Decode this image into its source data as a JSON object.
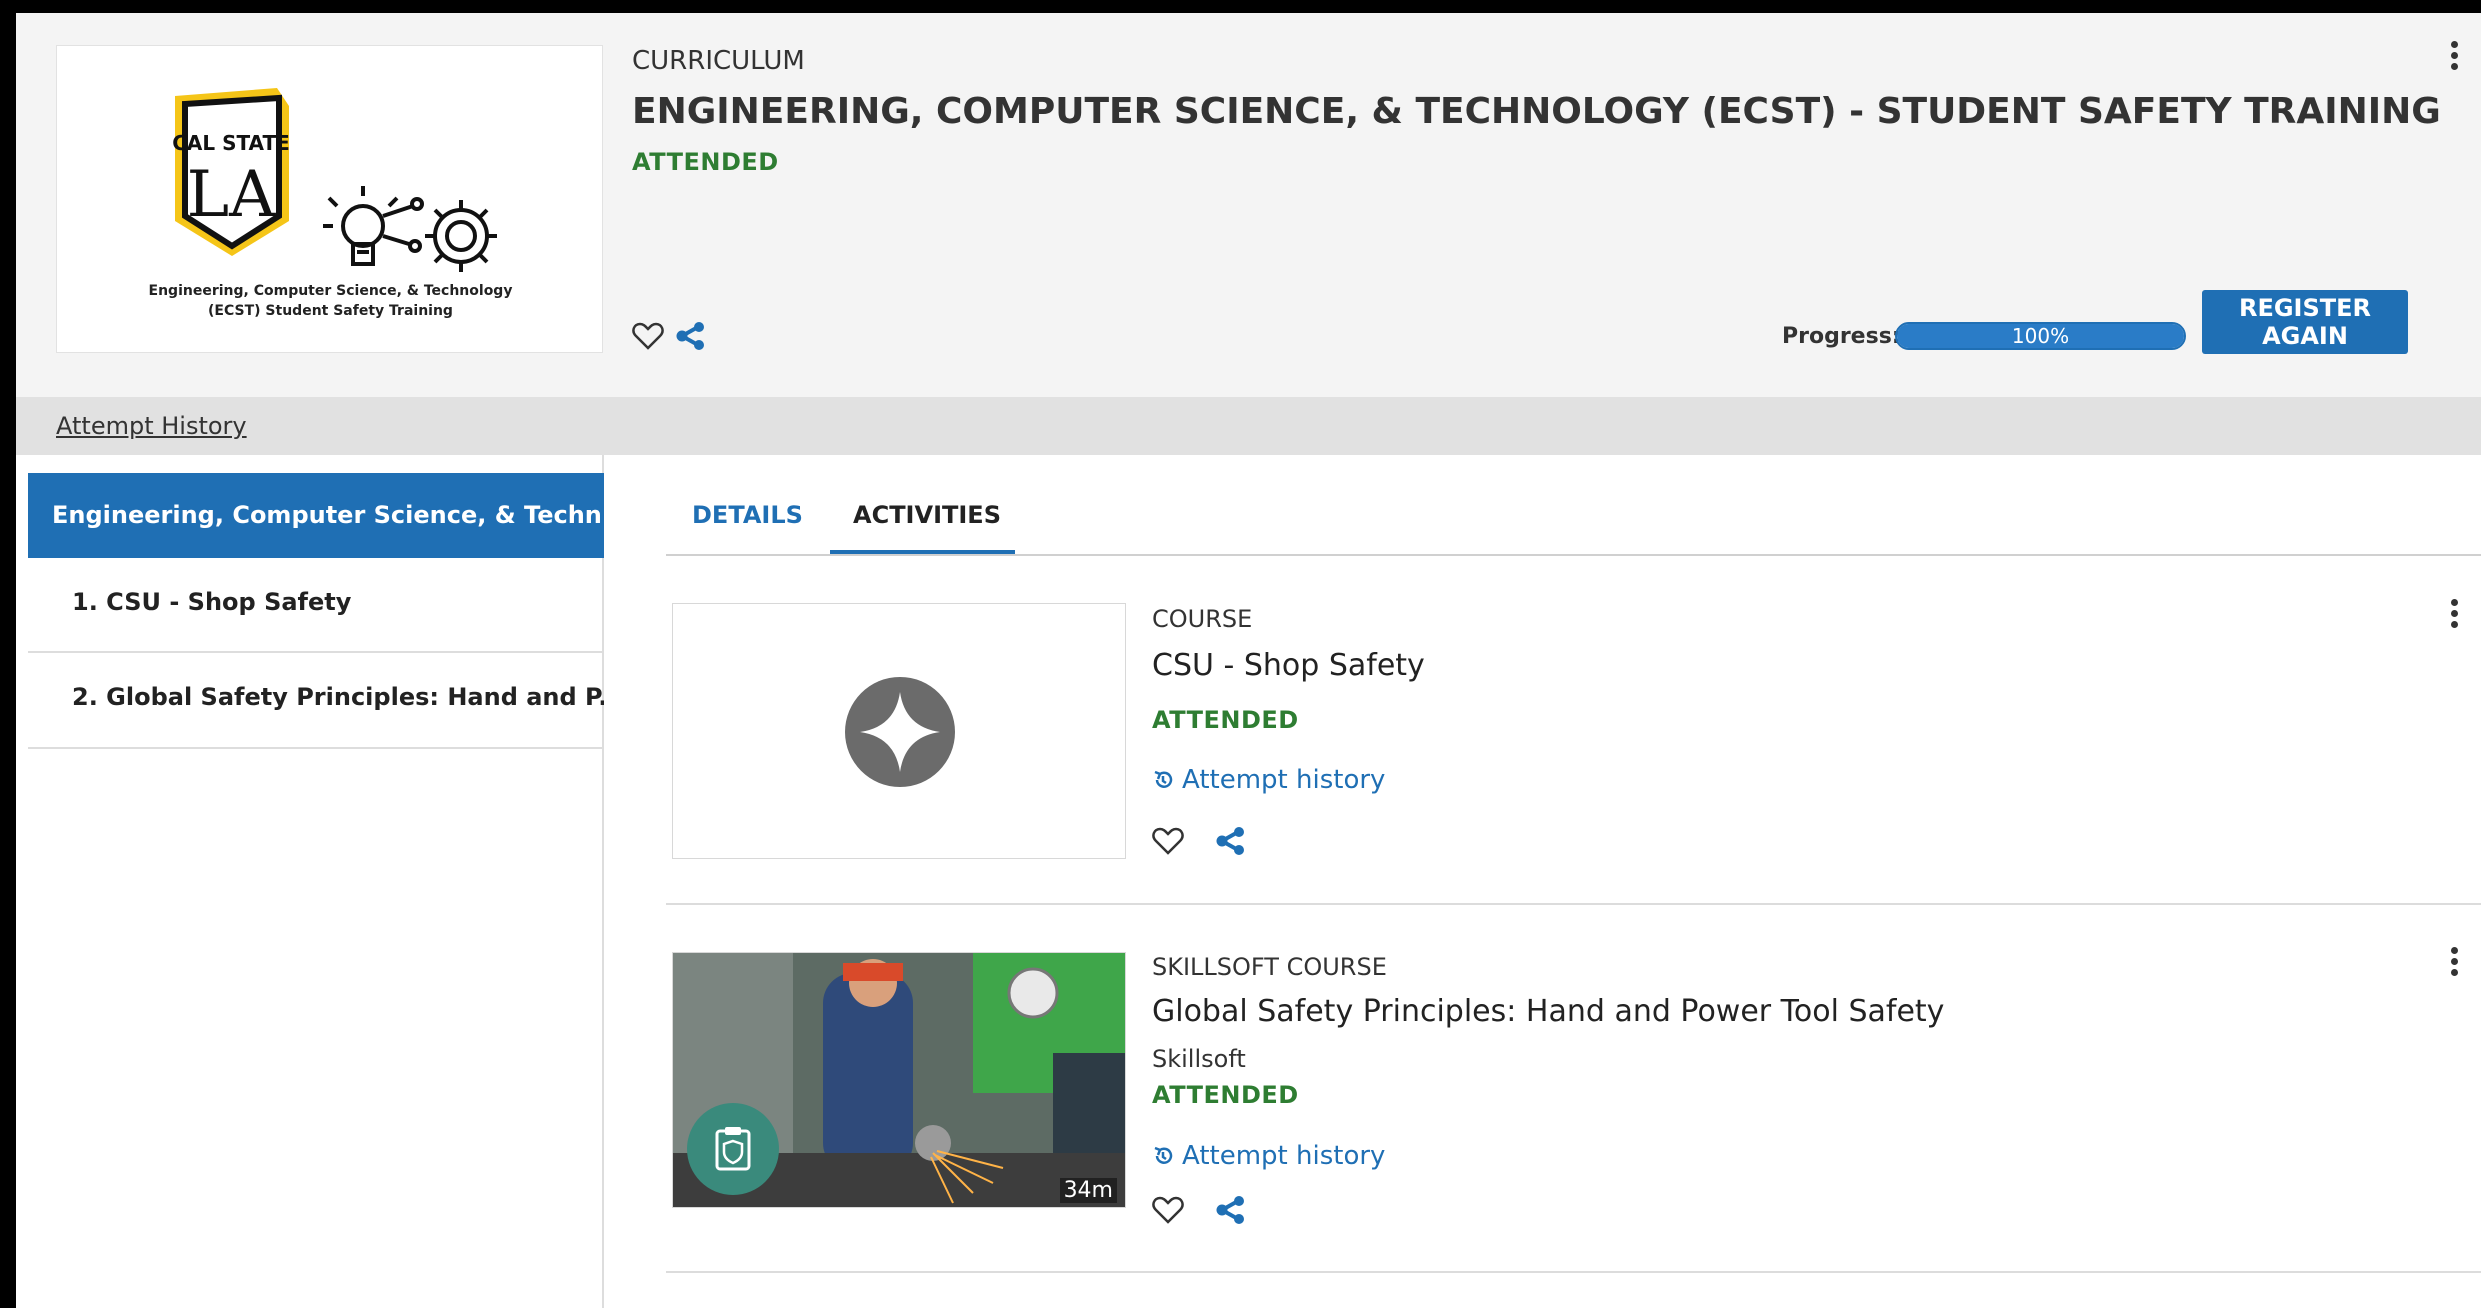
{
  "header": {
    "logo": {
      "brand_top": "CAL STATE",
      "brand_mark": "LA",
      "caption_line1": "Engineering, Computer Science, & Technology",
      "caption_line2": "(ECST) Student Safety Training"
    },
    "type_label": "CURRICULUM",
    "title": "ENGINEERING, COMPUTER SCIENCE, & TECHNOLOGY (ECST) - STUDENT SAFETY TRAINING",
    "status": "ATTENDED",
    "progress_label": "Progress:",
    "progress_value": 1.0,
    "progress_text": "100%",
    "register_label": "REGISTER AGAIN"
  },
  "attempt_history_link": "Attempt History",
  "sidebar": {
    "items": [
      {
        "label": "Engineering, Computer Science, & Techn..."
      },
      {
        "label": "1. CSU - Shop Safety"
      },
      {
        "label": "2. Global Safety Principles: Hand and P..."
      }
    ]
  },
  "tabs": [
    {
      "label": "DETAILS"
    },
    {
      "label": "ACTIVITIES"
    }
  ],
  "active_tab": "ACTIVITIES",
  "activities": [
    {
      "type": "COURSE",
      "title": "CSU - Shop Safety",
      "status": "ATTENDED",
      "attempt_link": "Attempt history"
    },
    {
      "type": "SKILLSOFT COURSE",
      "title": "Global Safety Principles: Hand and Power Tool Safety",
      "provider": "Skillsoft",
      "status": "ATTENDED",
      "attempt_link": "Attempt history",
      "duration": "34m"
    }
  ],
  "colors": {
    "accent": "#1f6fb4",
    "status_green": "#2e7d32",
    "header_bg": "#f4f4f4",
    "logo_gold": "#f5c518",
    "badge_teal": "#3a8a7c"
  },
  "icons": {
    "favorite": "heart-outline-icon",
    "share": "share-icon",
    "more": "kebab-menu-icon",
    "history": "history-icon",
    "course_placeholder": "sparkle-icon",
    "assessment_badge": "clipboard-shield-icon"
  }
}
